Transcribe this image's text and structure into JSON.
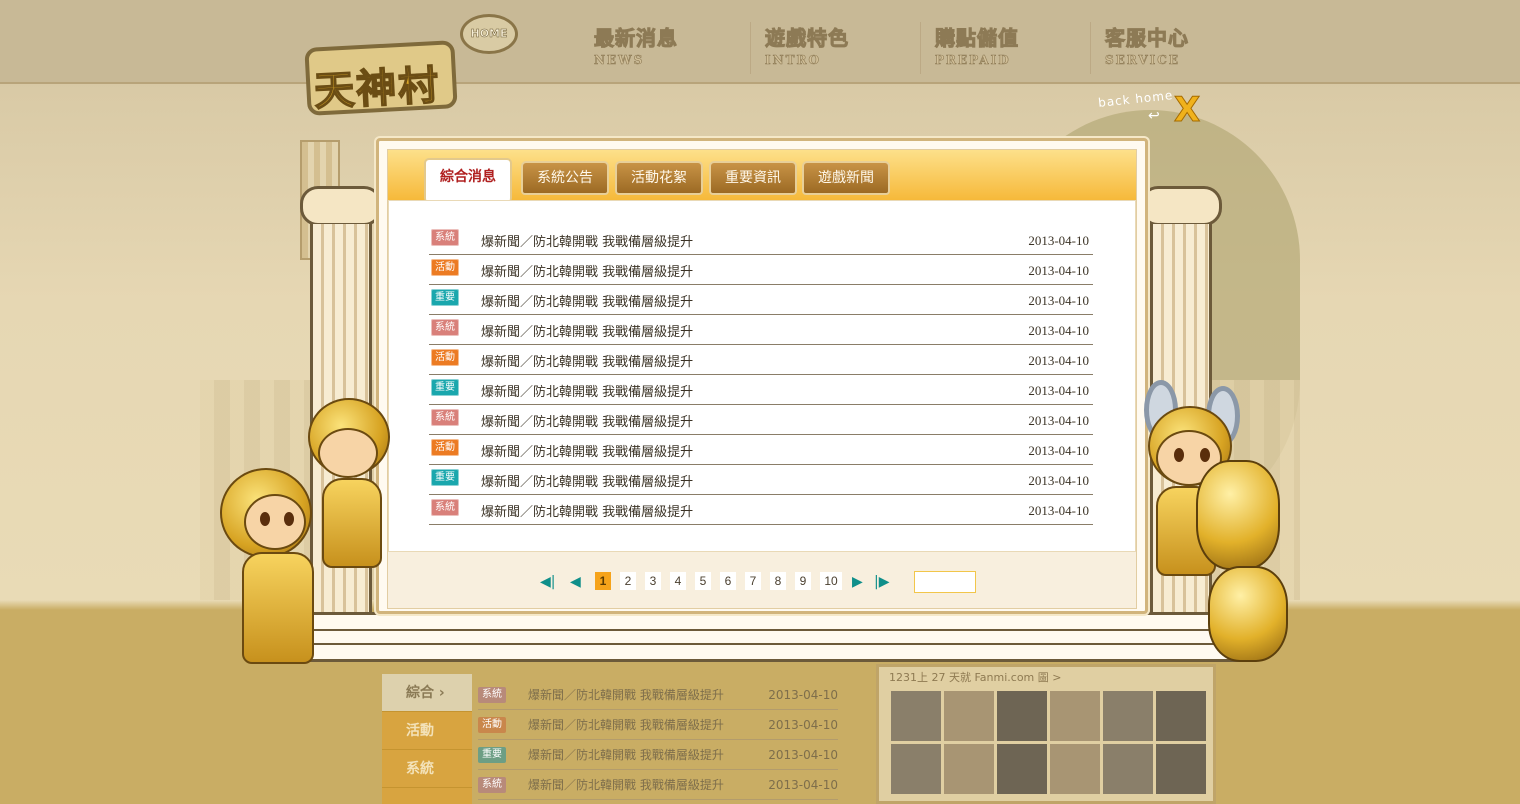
{
  "header": {
    "logo_text": "天神村",
    "home_bubble": "HOME",
    "nav": [
      {
        "cn": "最新消息",
        "en": "NEWS"
      },
      {
        "cn": "遊戲特色",
        "en": "INTRO"
      },
      {
        "cn": "購點儲值",
        "en": "PREPAID"
      },
      {
        "cn": "客服中心",
        "en": "SERVICE"
      }
    ],
    "back_home": "back home",
    "close_glyph": "X"
  },
  "modal": {
    "tabs": [
      "綜合消息",
      "系統公告",
      "活動花絮",
      "重要資訊",
      "遊戲新聞"
    ],
    "active_tab": 0,
    "rows": [
      {
        "badge": "系統",
        "type": "sys",
        "title": "爆新聞／防北韓開戰 我戰備層級提升",
        "date": "2013-04-10"
      },
      {
        "badge": "活動",
        "type": "act",
        "title": "爆新聞／防北韓開戰 我戰備層級提升",
        "date": "2013-04-10"
      },
      {
        "badge": "重要",
        "type": "imp",
        "title": "爆新聞／防北韓開戰 我戰備層級提升",
        "date": "2013-04-10"
      },
      {
        "badge": "系統",
        "type": "sys",
        "title": "爆新聞／防北韓開戰 我戰備層級提升",
        "date": "2013-04-10"
      },
      {
        "badge": "活動",
        "type": "act",
        "title": "爆新聞／防北韓開戰 我戰備層級提升",
        "date": "2013-04-10"
      },
      {
        "badge": "重要",
        "type": "imp",
        "title": "爆新聞／防北韓開戰 我戰備層級提升",
        "date": "2013-04-10"
      },
      {
        "badge": "系統",
        "type": "sys",
        "title": "爆新聞／防北韓開戰 我戰備層級提升",
        "date": "2013-04-10"
      },
      {
        "badge": "活動",
        "type": "act",
        "title": "爆新聞／防北韓開戰 我戰備層級提升",
        "date": "2013-04-10"
      },
      {
        "badge": "重要",
        "type": "imp",
        "title": "爆新聞／防北韓開戰 我戰備層級提升",
        "date": "2013-04-10"
      },
      {
        "badge": "系統",
        "type": "sys",
        "title": "爆新聞／防北韓開戰 我戰備層級提升",
        "date": "2013-04-10"
      }
    ],
    "pager": {
      "pages": [
        "1",
        "2",
        "3",
        "4",
        "5",
        "6",
        "7",
        "8",
        "9",
        "10"
      ],
      "current": "1",
      "first_glyph": "◀|",
      "prev_glyph": "◀",
      "next_glyph": "▶",
      "last_glyph": "|▶",
      "jump_value": ""
    }
  },
  "background": {
    "categories": [
      "綜合",
      "活動",
      "系統"
    ],
    "category_arrow": "›",
    "rows": [
      {
        "badge": "系統",
        "title": "爆新聞／防北韓開戰 我戰備層級提升",
        "date": "2013-04-10"
      },
      {
        "badge": "活動",
        "title": "爆新聞／防北韓開戰 我戰備層級提升",
        "date": "2013-04-10"
      },
      {
        "badge": "重要",
        "title": "爆新聞／防北韓開戰 我戰備層級提升",
        "date": "2013-04-10"
      },
      {
        "badge": "系統",
        "title": "爆新聞／防北韓開戰 我戰備層級提升",
        "date": "2013-04-10"
      }
    ],
    "gallery_caption": "1231上 27 天就 Fanmi.com 圖 >"
  },
  "colors": {
    "badge_sys": "#d9807a",
    "badge_act": "#ec7b22",
    "badge_imp": "#1aa7ad",
    "active_tab_text": "#b02020",
    "current_page": "#f6a31a",
    "pager_arrow": "#0f8f8a"
  }
}
